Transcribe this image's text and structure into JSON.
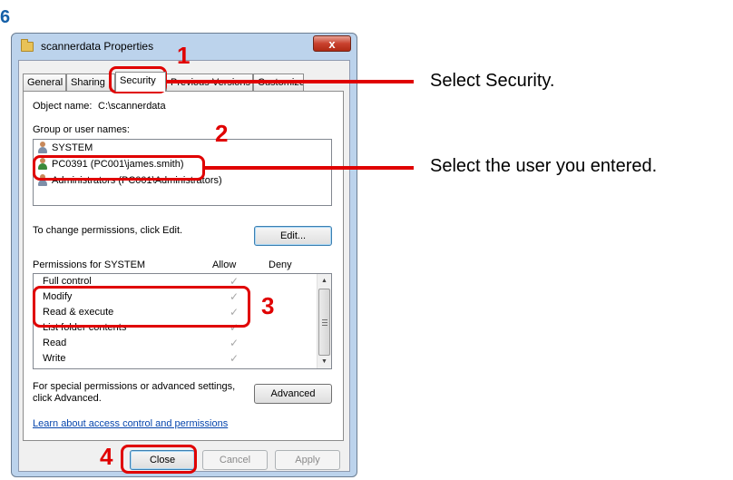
{
  "steps": {
    "main": "6",
    "s1": "1",
    "s2": "2",
    "s3": "3",
    "s4": "4"
  },
  "annotations": {
    "a1": "Select Security.",
    "a2": "Select the user you entered."
  },
  "window": {
    "title": "scannerdata Properties",
    "close_glyph": "x"
  },
  "tabs": [
    "General",
    "Sharing",
    "Security",
    "Previous Versions",
    "Customize"
  ],
  "security": {
    "object_name_label": "Object name:",
    "object_name_value": "C:\\scannerdata",
    "group_label": "Group or user names:",
    "users": [
      "SYSTEM",
      "PC0391 (PC001\\james.smith)",
      "Administrators (PC001\\Administrators)"
    ],
    "change_text": "To change permissions, click Edit.",
    "edit_button": "Edit...",
    "perm_header": "Permissions for SYSTEM",
    "allow_header": "Allow",
    "deny_header": "Deny",
    "permissions": [
      "Full control",
      "Modify",
      "Read & execute",
      "List folder contents",
      "Read",
      "Write"
    ],
    "check_glyph": "✓",
    "special_text": "For special permissions or advanced settings, click Advanced.",
    "advanced_button": "Advanced",
    "link_text": "Learn about access control and permissions"
  },
  "buttons": {
    "close": "Close",
    "cancel": "Cancel",
    "apply": "Apply"
  },
  "colors": {
    "highlight": "#e00000",
    "step_blue": "#1560a8"
  }
}
